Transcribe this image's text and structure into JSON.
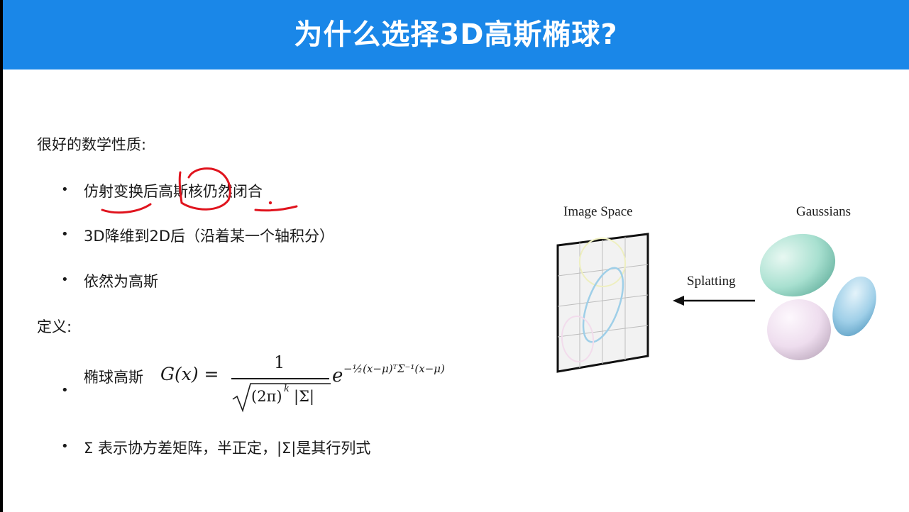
{
  "title": "为什么选择3D高斯椭球?",
  "section_properties": "很好的数学性质:",
  "bullets_properties": [
    {
      "pre": "仿射变换后",
      "mid": "高斯核",
      "post": "仍然闭合"
    },
    {
      "text": "3D降维到2D后（沿着某一个轴积分）"
    },
    {
      "text": "依然为高斯"
    }
  ],
  "section_definition": "定义:",
  "formula": {
    "label": "椭球高斯",
    "lhs": "G(x) =",
    "numerator": "1",
    "denominator_inner": "(2π)",
    "denominator_exp": "k",
    "denominator_det": "|Σ|",
    "base": "e",
    "exponent": "−½(x−μ)ᵀΣ⁻¹(x−μ)"
  },
  "bullet_sigma": "Σ 表示协方差矩阵，半正定，|Σ|是其行列式",
  "figure": {
    "image_space_label": "Image Space",
    "gaussians_label": "Gaussians",
    "arrow_label": "Splatting"
  },
  "colors": {
    "header": "#1a87e8",
    "annotation": "#e0141e",
    "grid": "#bdbdbd",
    "teal_gaussian": "#a8e0d0",
    "blue_gaussian": "#9fcfe8",
    "pink_gaussian": "#eeddee"
  }
}
